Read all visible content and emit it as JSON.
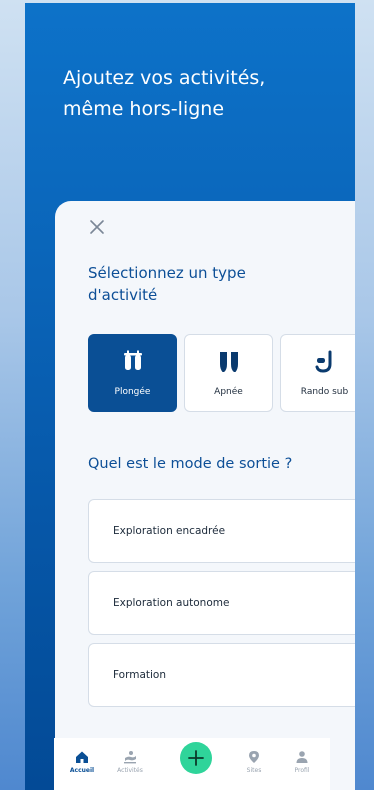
{
  "hero": {
    "headline": "Ajoutez vos activités,\nmême hors-ligne"
  },
  "sheet": {
    "close_icon": "close-icon",
    "title": "Sélectionnez un type\nd'activité",
    "activity_types": [
      {
        "label": "Plongée",
        "icon": "diving-tanks-icon",
        "selected": true
      },
      {
        "label": "Apnée",
        "icon": "fins-icon",
        "selected": false
      },
      {
        "label": "Rando sub",
        "icon": "snorkel-icon",
        "selected": false
      }
    ],
    "mode_question": "Quel est le mode de sortie ?",
    "modes": [
      {
        "label": "Exploration encadrée"
      },
      {
        "label": "Exploration autonome"
      },
      {
        "label": "Formation"
      }
    ]
  },
  "nav": {
    "items": [
      {
        "label": "Accueil",
        "icon": "home-icon",
        "active": true
      },
      {
        "label": "Activités",
        "icon": "activities-icon",
        "active": false
      },
      {
        "label": "",
        "icon": "plus-icon",
        "active": false
      },
      {
        "label": "Sites",
        "icon": "location-pin-icon",
        "active": false
      },
      {
        "label": "Profil",
        "icon": "profile-icon",
        "active": false
      }
    ]
  },
  "colors": {
    "primary": "#0a4f95",
    "hero_blue": "#0a64b8",
    "accent_green": "#2fd49a",
    "text_blue": "#0d4f97"
  }
}
